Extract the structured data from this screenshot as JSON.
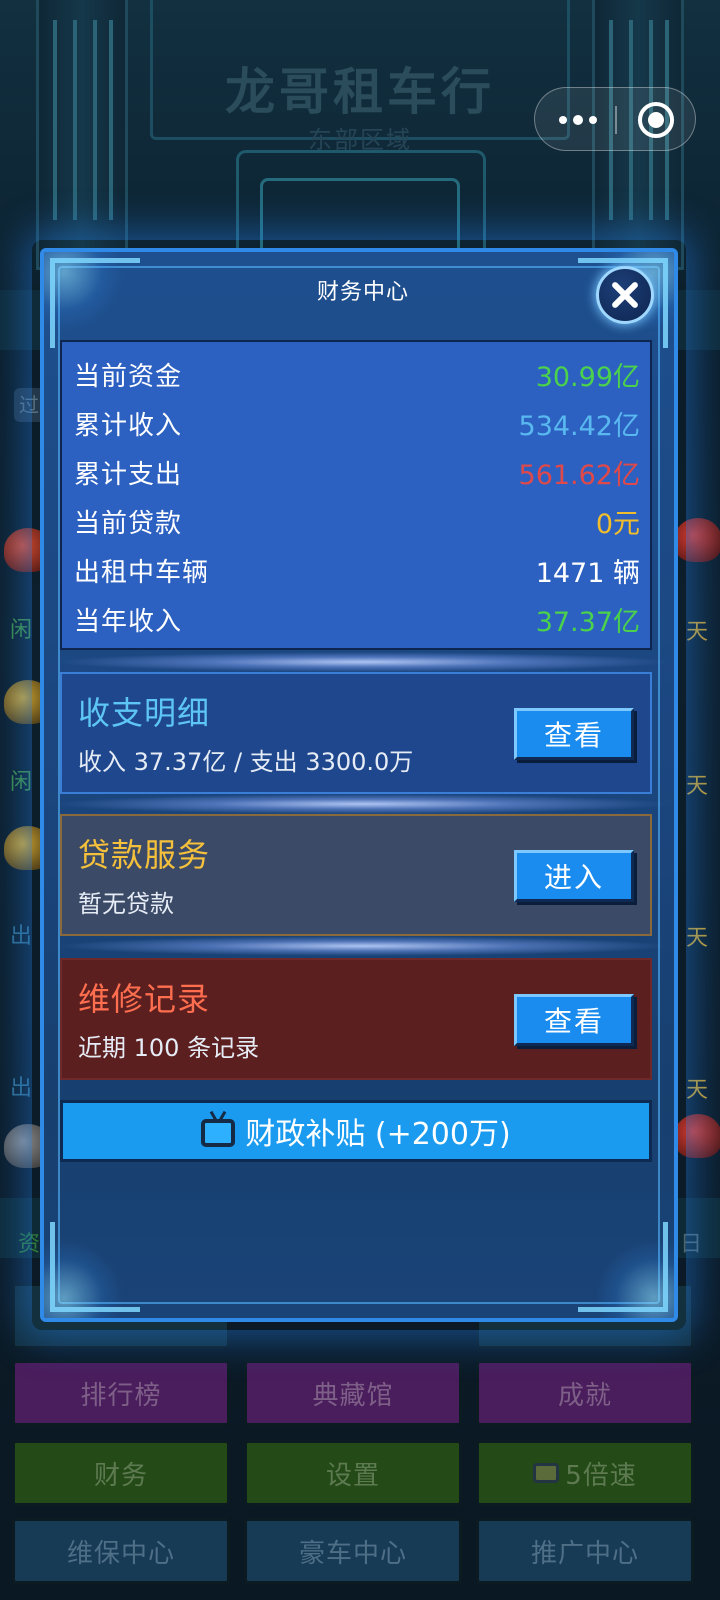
{
  "app": {
    "shop_name": "龙哥租车行",
    "region": "东部区域"
  },
  "background": {
    "side_labels_left": [
      "闲",
      "闲",
      "出",
      "出"
    ],
    "side_labels_right": [
      "天",
      "天",
      "天",
      "天"
    ],
    "strip_left": "资",
    "strip_right": "日",
    "left_letter": "过"
  },
  "bottom_menu": [
    {
      "label": "排行榜",
      "color": "purple"
    },
    {
      "label": "典藏馆",
      "color": "purple"
    },
    {
      "label": "成就",
      "color": "purple"
    },
    {
      "label": "财务",
      "color": "green"
    },
    {
      "label": "设置",
      "color": "green"
    },
    {
      "label": "5倍速",
      "color": "green",
      "icon": "tv-icon"
    },
    {
      "label": "维保中心",
      "color": "teal"
    },
    {
      "label": "豪车中心",
      "color": "teal"
    },
    {
      "label": "推广中心",
      "color": "teal"
    }
  ],
  "modal": {
    "title": "财务中心",
    "stats": [
      {
        "label": "当前资金",
        "value": "30.99亿",
        "color": "#4bd14b"
      },
      {
        "label": "累计收入",
        "value": "534.42亿",
        "color": "#5ab8f0"
      },
      {
        "label": "累计支出",
        "value": "561.62亿",
        "color": "#e0494a"
      },
      {
        "label": "当前贷款",
        "value": "0元",
        "color": "#f0bd2c"
      },
      {
        "label": "出租中车辆",
        "value": "1471 辆",
        "color": "#ffffff"
      },
      {
        "label": "当年收入",
        "value": "37.37亿",
        "color": "#4bd14b"
      }
    ],
    "cards": [
      {
        "title": "收支明细",
        "subtitle": "收入 37.37亿 / 支出 3300.0万",
        "button": "查看",
        "title_color": "#5ec6f5"
      },
      {
        "title": "贷款服务",
        "subtitle": "暂无贷款",
        "button": "进入",
        "title_color": "#f5c03b"
      },
      {
        "title": "维修记录",
        "subtitle": "近期 100 条记录",
        "button": "查看",
        "title_color": "#ff6e4f"
      }
    ],
    "subsidy_button": "财政补贴 (+200万)"
  }
}
